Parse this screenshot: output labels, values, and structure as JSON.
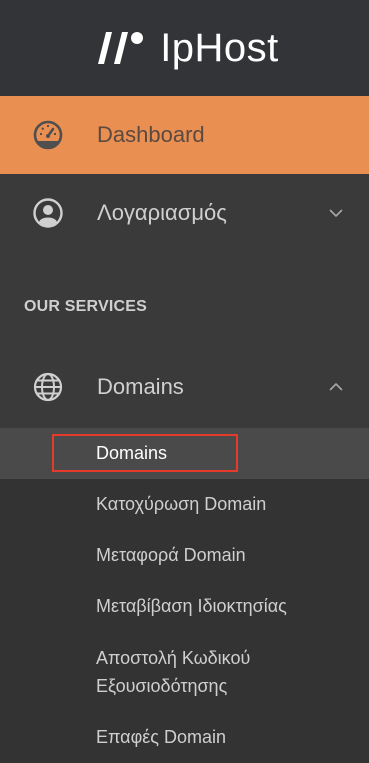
{
  "brand": {
    "name": "IpHost",
    "logo_icon": "iphost-logo-icon"
  },
  "nav": {
    "dashboard": {
      "label": "Dashboard",
      "icon": "dashboard-gauge-icon"
    },
    "account": {
      "label": "Λογαριασμός",
      "icon": "user-circle-icon",
      "chevron": "chevron-down-icon"
    }
  },
  "section": {
    "title": "OUR SERVICES"
  },
  "domains": {
    "label": "Domains",
    "icon": "globe-icon",
    "chevron": "chevron-up-icon",
    "sub": [
      {
        "label": "Domains"
      },
      {
        "label": "Κατοχύρωση Domain"
      },
      {
        "label": "Μεταφορά Domain"
      },
      {
        "label": "Μεταβίβαση Ιδιοκτησίας"
      },
      {
        "line1": "Αποστολή Κωδικού",
        "line2": "Εξουσιοδότησης"
      },
      {
        "label": "Επαφές Domain"
      }
    ]
  },
  "colors": {
    "accent": "#e98f52",
    "sidebar": "#3a3a3a",
    "header": "#333437",
    "highlight_border": "#e53b2c"
  }
}
